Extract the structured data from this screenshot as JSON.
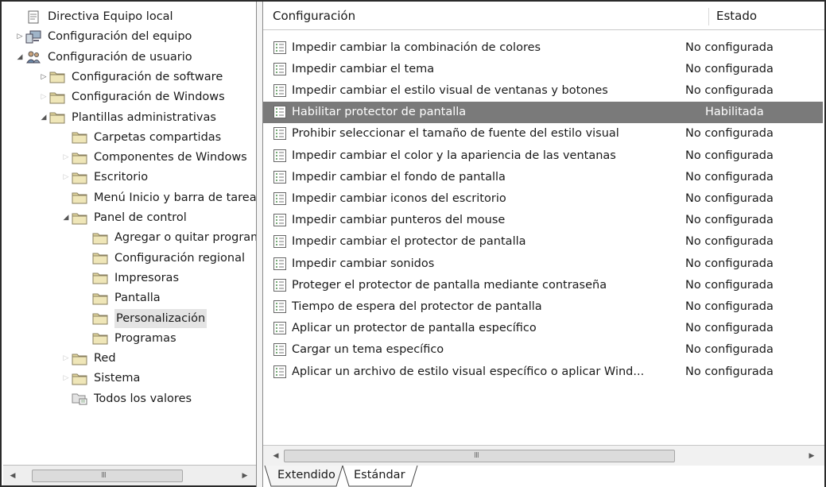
{
  "tree": {
    "items": [
      {
        "label": "Directiva Equipo local",
        "arrow": "",
        "icon": "policy-doc-icon",
        "level": 0
      },
      {
        "label": "Configuración del equipo",
        "arrow": "▷",
        "icon": "computer-icon",
        "level": 0
      },
      {
        "label": "Configuración de usuario",
        "arrow": "◢",
        "icon": "users-icon",
        "level": 0
      },
      {
        "label": "Configuración de software",
        "arrow": "▷",
        "icon": "folder-icon",
        "level": 1
      },
      {
        "label": "Configuración de Windows",
        "arrow": "▷",
        "icon": "folder-icon",
        "level": 1
      },
      {
        "label": "Plantillas administrativas",
        "arrow": "◢",
        "icon": "folder-icon",
        "level": 1
      },
      {
        "label": "Carpetas compartidas",
        "arrow": "",
        "icon": "folder-icon",
        "level": 2
      },
      {
        "label": "Componentes de Windows",
        "arrow": "▷",
        "icon": "folder-icon",
        "level": 2
      },
      {
        "label": "Escritorio",
        "arrow": "▷",
        "icon": "folder-icon",
        "level": 2
      },
      {
        "label": "Menú Inicio y barra de tareas",
        "arrow": "",
        "icon": "folder-icon",
        "level": 2
      },
      {
        "label": "Panel de control",
        "arrow": "◢",
        "icon": "folder-icon",
        "level": 2
      },
      {
        "label": "Agregar o quitar programas",
        "arrow": "",
        "icon": "folder-icon",
        "level": 3
      },
      {
        "label": "Configuración regional",
        "arrow": "",
        "icon": "folder-icon",
        "level": 3
      },
      {
        "label": "Impresoras",
        "arrow": "",
        "icon": "folder-icon",
        "level": 3
      },
      {
        "label": "Pantalla",
        "arrow": "",
        "icon": "folder-icon",
        "level": 3
      },
      {
        "label": "Personalización",
        "arrow": "",
        "icon": "folder-icon",
        "level": 3,
        "highlighted": true
      },
      {
        "label": "Programas",
        "arrow": "",
        "icon": "folder-icon",
        "level": 3
      },
      {
        "label": "Red",
        "arrow": "▷",
        "icon": "folder-icon",
        "level": 2
      },
      {
        "label": "Sistema",
        "arrow": "▷",
        "icon": "folder-icon",
        "level": 2
      },
      {
        "label": "Todos los valores",
        "arrow": "",
        "icon": "all-settings-icon",
        "level": 2
      }
    ]
  },
  "list": {
    "columns": {
      "name": "Configuración",
      "state": "Estado"
    },
    "rows": [
      {
        "name": "Impedir cambiar la combinación de colores",
        "state": "No configurada"
      },
      {
        "name": "Impedir cambiar el tema",
        "state": "No configurada"
      },
      {
        "name": "Impedir cambiar el estilo visual de ventanas y botones",
        "state": "No configurada"
      },
      {
        "name": "Habilitar protector de pantalla",
        "state": "Habilitada",
        "selected": true
      },
      {
        "name": "Prohibir seleccionar el tamaño de fuente del estilo visual",
        "state": "No configurada"
      },
      {
        "name": "Impedir cambiar el color y la apariencia de las ventanas",
        "state": "No configurada"
      },
      {
        "name": "Impedir cambiar el fondo de pantalla",
        "state": "No configurada"
      },
      {
        "name": "Impedir cambiar iconos del escritorio",
        "state": "No configurada"
      },
      {
        "name": "Impedir cambiar punteros del mouse",
        "state": "No configurada"
      },
      {
        "name": "Impedir cambiar el protector de pantalla",
        "state": "No configurada"
      },
      {
        "name": "Impedir cambiar sonidos",
        "state": "No configurada"
      },
      {
        "name": "Proteger el protector de pantalla mediante contraseña",
        "state": "No configurada"
      },
      {
        "name": "Tiempo de espera del protector de pantalla",
        "state": "No configurada"
      },
      {
        "name": "Aplicar un protector de pantalla específico",
        "state": "No configurada"
      },
      {
        "name": "Cargar un tema específico",
        "state": "No configurada"
      },
      {
        "name": "Aplicar un archivo de estilo visual específico o aplicar Wind...",
        "state": "No configurada"
      }
    ]
  },
  "tabs": [
    {
      "label": "Extendido",
      "active": false
    },
    {
      "label": "Estándar",
      "active": true
    }
  ],
  "scrollbars": {
    "left_grip": "III",
    "right_grip": "III",
    "left_arrow": "◀",
    "right_arrow": "▶"
  },
  "colors": {
    "selected_row": "#7a7a7a",
    "folder": "#d9c98a"
  }
}
